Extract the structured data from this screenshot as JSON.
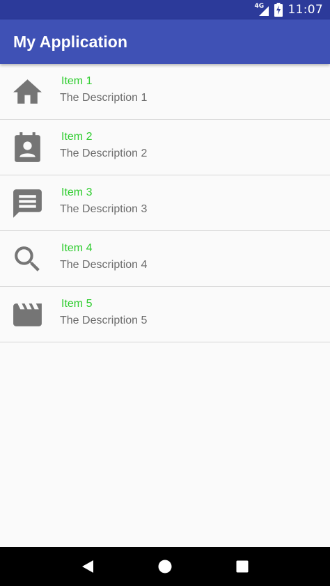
{
  "status_bar": {
    "network": "4G",
    "time": "11:07",
    "icons": [
      "signal-icon",
      "battery-charging-icon"
    ]
  },
  "app_bar": {
    "title": "My Application"
  },
  "list": {
    "items": [
      {
        "title": "Item 1",
        "description": "The Description 1",
        "icon": "home-icon"
      },
      {
        "title": "Item 2",
        "description": "The Description 2",
        "icon": "contact-card-icon"
      },
      {
        "title": "Item 3",
        "description": "The Description 3",
        "icon": "message-icon"
      },
      {
        "title": "Item 4",
        "description": "The Description 4",
        "icon": "search-icon"
      },
      {
        "title": "Item 5",
        "description": "The Description 5",
        "icon": "movie-clapper-icon"
      }
    ]
  },
  "colors": {
    "status_bar": "#2c3a9a",
    "app_bar": "#3f51b5",
    "item_title": "#2ecc2e",
    "item_description": "#6b6b6b",
    "icon": "#757575",
    "background": "#fafafa"
  },
  "nav_bar": {
    "icons": [
      "back-icon",
      "home-circle-icon",
      "recents-icon"
    ]
  }
}
